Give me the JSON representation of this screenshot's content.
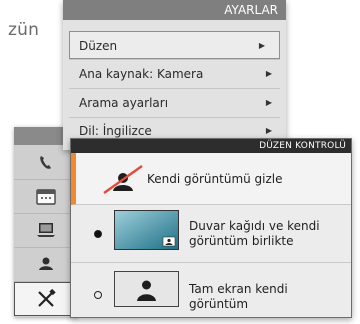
{
  "background": {
    "partial_text": "zün"
  },
  "settings_menu": {
    "title": "AYARLAR",
    "items": [
      {
        "label": "Düzen",
        "icon": "arrow-right-icon",
        "active": true
      },
      {
        "label": "Ana kaynak: Kamera",
        "icon": "arrow-right-icon"
      },
      {
        "label": "Arama ayarları",
        "icon": "arrow-right-icon"
      },
      {
        "label": "Dil: İngilizce",
        "icon": "arrow-right-icon"
      }
    ]
  },
  "side_panel": {
    "icons": [
      "phone-icon",
      "calendar-icon",
      "laptop-icon",
      "self-view-icon",
      "tools-icon"
    ],
    "selected_index": 4
  },
  "layout_control": {
    "title": "DÜZEN KONTROLÜ",
    "hide_self_view": {
      "label": "Kendi görüntümü gizle",
      "icon": "self-view-hidden-icon",
      "accent": "#f08a2c"
    },
    "options": [
      {
        "label_line1": "Duvar kağıdı ve kendi",
        "label_line2": "görüntüm birlikte",
        "selected": true,
        "icon": "wallpaper-with-pip-icon"
      },
      {
        "label_line1": "Tam ekran kendi",
        "label_line2": "görüntüm",
        "selected": false,
        "icon": "fullscreen-self-view-icon"
      }
    ]
  }
}
